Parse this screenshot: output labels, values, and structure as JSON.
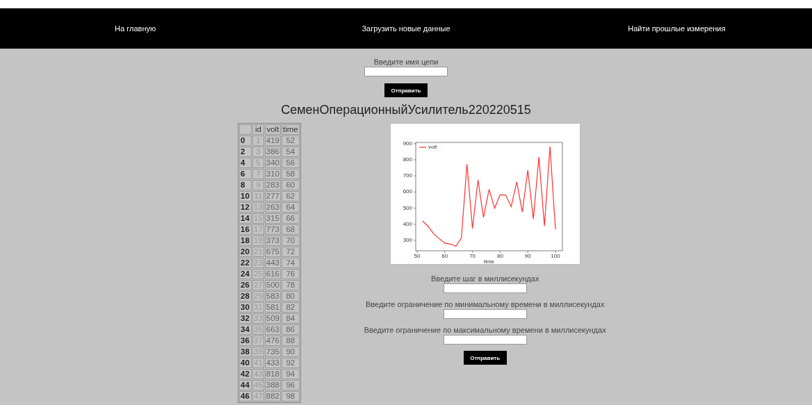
{
  "nav": [
    {
      "label": "На главную"
    },
    {
      "label": "Загрузить новые данные"
    },
    {
      "label": "Найти прошлые измерения"
    }
  ],
  "circuit_form": {
    "label": "Введите имя цепи",
    "button": "Отправить"
  },
  "heading": "СеменОперационныйУсилитель220220515",
  "table": {
    "columns": [
      "id",
      "volt",
      "time"
    ],
    "rows": [
      {
        "index": "0",
        "cells": [
          "1",
          "419",
          "52"
        ]
      },
      {
        "index": "2",
        "cells": [
          "3",
          "386",
          "54"
        ]
      },
      {
        "index": "4",
        "cells": [
          "5",
          "340",
          "56"
        ]
      },
      {
        "index": "6",
        "cells": [
          "7",
          "310",
          "58"
        ]
      },
      {
        "index": "8",
        "cells": [
          "9",
          "283",
          "60"
        ]
      },
      {
        "index": "10",
        "cells": [
          "11",
          "277",
          "62"
        ]
      },
      {
        "index": "12",
        "cells": [
          "13",
          "263",
          "64"
        ]
      },
      {
        "index": "14",
        "cells": [
          "15",
          "315",
          "66"
        ]
      },
      {
        "index": "16",
        "cells": [
          "17",
          "773",
          "68"
        ]
      },
      {
        "index": "18",
        "cells": [
          "19",
          "373",
          "70"
        ]
      },
      {
        "index": "20",
        "cells": [
          "21",
          "675",
          "72"
        ]
      },
      {
        "index": "22",
        "cells": [
          "23",
          "443",
          "74"
        ]
      },
      {
        "index": "24",
        "cells": [
          "25",
          "616",
          "76"
        ]
      },
      {
        "index": "26",
        "cells": [
          "27",
          "500",
          "78"
        ]
      },
      {
        "index": "28",
        "cells": [
          "29",
          "583",
          "80"
        ]
      },
      {
        "index": "30",
        "cells": [
          "31",
          "581",
          "82"
        ]
      },
      {
        "index": "32",
        "cells": [
          "33",
          "509",
          "84"
        ]
      },
      {
        "index": "34",
        "cells": [
          "35",
          "663",
          "86"
        ]
      },
      {
        "index": "36",
        "cells": [
          "37",
          "476",
          "88"
        ]
      },
      {
        "index": "38",
        "cells": [
          "39",
          "735",
          "90"
        ]
      },
      {
        "index": "40",
        "cells": [
          "41",
          "433",
          "92"
        ]
      },
      {
        "index": "42",
        "cells": [
          "43",
          "818",
          "94"
        ]
      },
      {
        "index": "44",
        "cells": [
          "45",
          "388",
          "96"
        ]
      },
      {
        "index": "46",
        "cells": [
          "47",
          "882",
          "98"
        ]
      }
    ]
  },
  "chart_data": {
    "type": "line",
    "xlabel": "time",
    "x": [
      52,
      54,
      56,
      58,
      60,
      62,
      64,
      66,
      68,
      70,
      72,
      74,
      76,
      78,
      80,
      82,
      84,
      86,
      88,
      90,
      92,
      94,
      96,
      98,
      100
    ],
    "series": [
      {
        "name": "volt",
        "color": "#ff3030",
        "values": [
          419,
          386,
          340,
          310,
          283,
          277,
          263,
          315,
          773,
          373,
          675,
          443,
          616,
          500,
          583,
          581,
          509,
          663,
          476,
          735,
          433,
          818,
          388,
          882,
          368
        ]
      }
    ],
    "xlim": [
      49.5,
      102.5
    ],
    "ylim": [
      235,
      908
    ],
    "xticks": [
      50,
      60,
      70,
      80,
      90,
      100
    ],
    "yticks": [
      300,
      400,
      500,
      600,
      700,
      800,
      900
    ]
  },
  "filter_form": {
    "fields": [
      {
        "label": "Введите шаг в миллисекундах"
      },
      {
        "label": "Введите ограничение по минимальному времени в миллисекундах"
      },
      {
        "label": "Введите ограничение по максимальному времени в миллисекундах"
      }
    ],
    "button": "Отправить"
  }
}
